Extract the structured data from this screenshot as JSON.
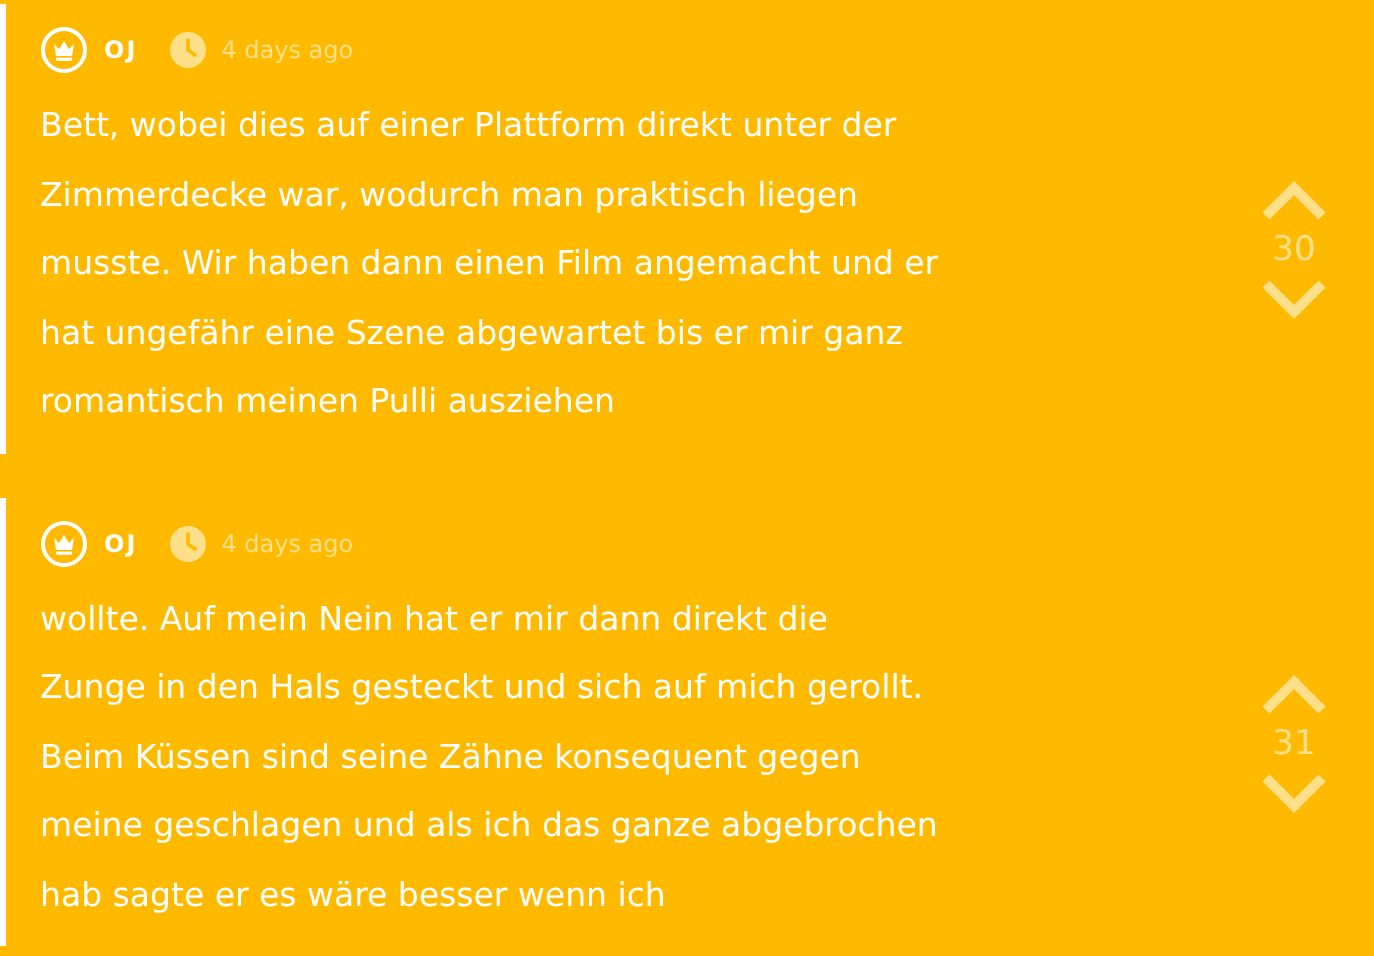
{
  "posts": [
    {
      "author": "OJ",
      "time": "4 days ago",
      "text": "Bett, wobei dies auf einer Plattform direkt unter der\nZimmerdecke war, wodurch man praktisch liegen\nmusste. Wir haben dann einen Film angemacht und er\nhat ungefähr eine Szene abgewartet bis er mir ganz\nromantisch meinen Pulli ausziehen",
      "votes": "30"
    },
    {
      "author": "OJ",
      "time": "4 days ago",
      "text": "wollte. Auf mein Nein hat er mir dann direkt die\nZunge in den Hals gesteckt und sich auf mich gerollt.\nBeim Küssen sind seine Zähne konsequent gegen\nmeine geschlagen und als ich das ganze abgebrochen\nhab sagte er es wäre besser wenn ich",
      "votes": "31"
    }
  ]
}
